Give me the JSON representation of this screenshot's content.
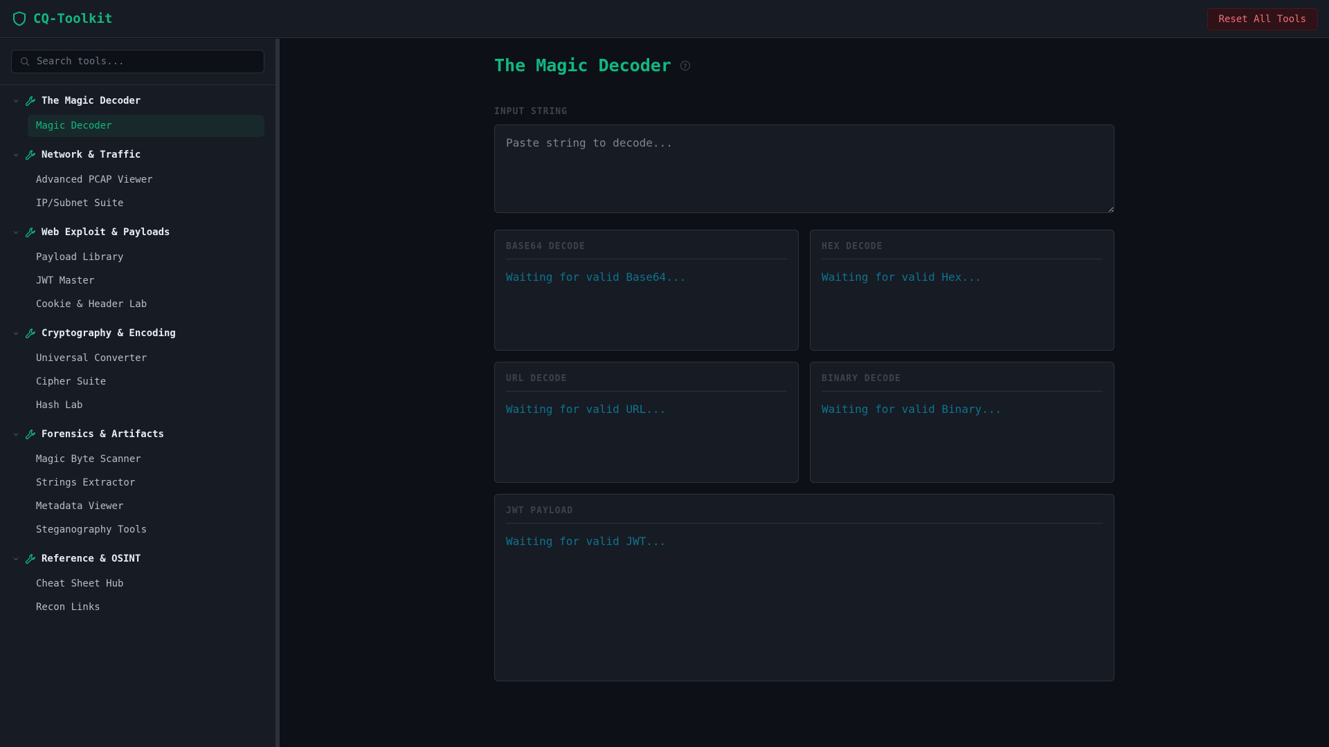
{
  "app": {
    "title": "CQ-Toolkit",
    "reset_label": "Reset All Tools"
  },
  "sidebar": {
    "search_placeholder": "Search tools...",
    "categories": [
      {
        "label": "The Magic Decoder",
        "items": [
          "Magic Decoder"
        ]
      },
      {
        "label": "Network & Traffic",
        "items": [
          "Advanced PCAP Viewer",
          "IP/Subnet Suite"
        ]
      },
      {
        "label": "Web Exploit & Payloads",
        "items": [
          "Payload Library",
          "JWT Master",
          "Cookie & Header Lab"
        ]
      },
      {
        "label": "Cryptography & Encoding",
        "items": [
          "Universal Converter",
          "Cipher Suite",
          "Hash Lab"
        ]
      },
      {
        "label": "Forensics & Artifacts",
        "items": [
          "Magic Byte Scanner",
          "Strings Extractor",
          "Metadata Viewer",
          "Steganography Tools"
        ]
      },
      {
        "label": "Reference & OSINT",
        "items": [
          "Cheat Sheet Hub",
          "Recon Links"
        ]
      }
    ],
    "active": "Magic Decoder"
  },
  "main": {
    "title": "The Magic Decoder",
    "input_label": "INPUT STRING",
    "input_placeholder": "Paste string to decode...",
    "input_value": "",
    "cards": [
      {
        "title": "BASE64 DECODE",
        "status": "Waiting for valid Base64..."
      },
      {
        "title": "HEX DECODE",
        "status": "Waiting for valid Hex..."
      },
      {
        "title": "URL DECODE",
        "status": "Waiting for valid URL..."
      },
      {
        "title": "BINARY DECODE",
        "status": "Waiting for valid Binary..."
      },
      {
        "title": "JWT PAYLOAD",
        "status": "Waiting for valid JWT..."
      }
    ]
  }
}
